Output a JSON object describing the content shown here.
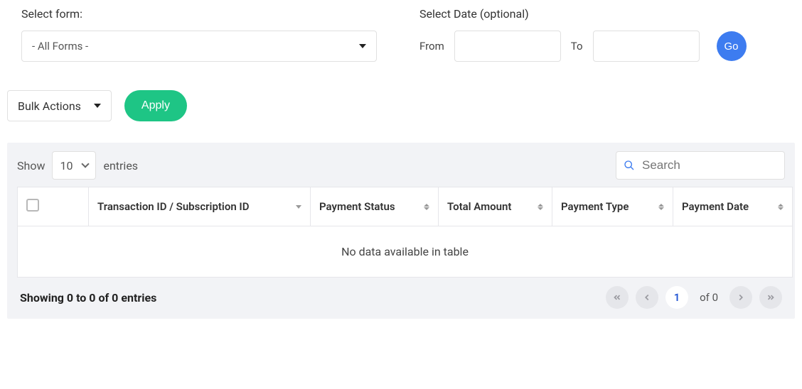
{
  "filters": {
    "select_form_label": "Select form:",
    "select_form_value": "- All Forms -",
    "select_date_label": "Select Date (optional)",
    "from_label": "From",
    "to_label": "To",
    "from_value": "",
    "to_value": "",
    "go_label": "Go"
  },
  "bulk": {
    "label": "Bulk Actions",
    "apply_label": "Apply"
  },
  "table": {
    "show_label": "Show",
    "entries_label": "entries",
    "page_size": "10",
    "search_placeholder": "Search",
    "columns": {
      "transaction": "Transaction ID / Subscription ID",
      "status": "Payment Status",
      "amount": "Total Amount",
      "type": "Payment Type",
      "date": "Payment Date"
    },
    "no_data": "No data available in table",
    "showing_text": "Showing 0 to 0 of 0 entries",
    "current_page": "1",
    "of_text": "of 0"
  }
}
